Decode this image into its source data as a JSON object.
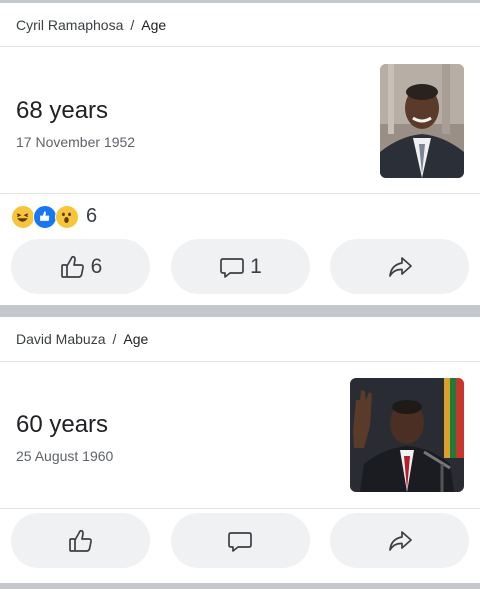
{
  "cards": [
    {
      "breadcrumb": {
        "person": "Cyril Ramaphosa",
        "separator": "/",
        "topic": "Age"
      },
      "age": "68 years",
      "dob": "17 November 1952",
      "reactions": {
        "emojis": [
          "laughing-emoji",
          "like-emoji",
          "wow-emoji"
        ],
        "count": "6"
      },
      "actions": {
        "like_count": "6",
        "comment_count": "1"
      }
    },
    {
      "breadcrumb": {
        "person": "David Mabuza",
        "separator": "/",
        "topic": "Age"
      },
      "age": "60 years",
      "dob": "25 August 1960",
      "actions": {}
    }
  ],
  "colors": {
    "pill_bg": "#f0f1f3",
    "separator": "#c4c7cc",
    "like_blue": "#1877f2",
    "emoji_yellow": "#f7c53b"
  }
}
